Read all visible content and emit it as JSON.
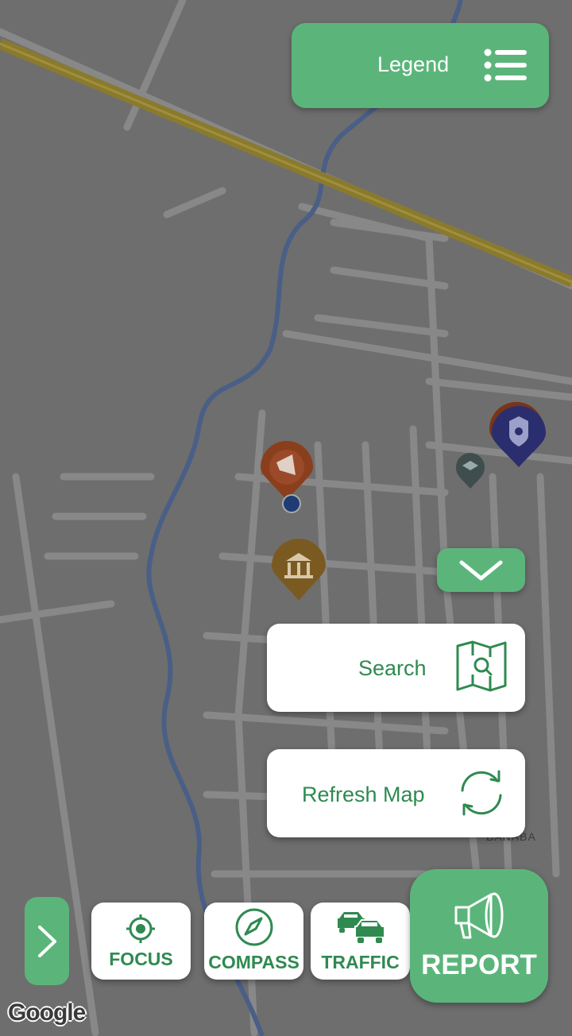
{
  "legend": {
    "label": "Legend",
    "icon": "list-icon"
  },
  "search": {
    "label": "Search",
    "icon": "map-search-icon"
  },
  "refresh": {
    "label": "Refresh Map",
    "icon": "refresh-icon"
  },
  "toolbar": {
    "focus_label": "FOCUS",
    "compass_label": "COMPASS",
    "traffic_label": "TRAFFIC",
    "report_label": "REPORT"
  },
  "map": {
    "attribution": "Google",
    "place_label": "BANABA",
    "markers": [
      "megaphone-marker",
      "bank-marker",
      "police-marker",
      "school-marker",
      "user-location"
    ]
  },
  "colors": {
    "accent": "#5bb57a",
    "accent_text": "#2f8a50",
    "map_dim": "#6e6e6e",
    "road": "#8a8a8a",
    "river": "#4a5f86",
    "highway": "#8a7a2e"
  }
}
